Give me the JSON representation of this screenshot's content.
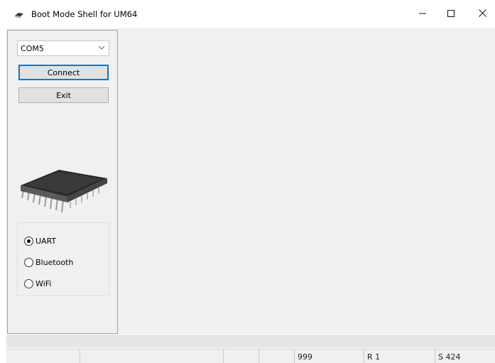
{
  "window": {
    "title": "Boot Mode Shell for UM64"
  },
  "controls": {
    "port_value": "COM5",
    "connect_label": "Connect",
    "exit_label": "Exit"
  },
  "radios": [
    {
      "label": "UART",
      "checked": true
    },
    {
      "label": "Bluetooth",
      "checked": false
    },
    {
      "label": "WiFi",
      "checked": false
    }
  ],
  "status": {
    "cells": [
      "",
      "",
      "",
      "",
      "999",
      "R 1",
      "S 424"
    ]
  },
  "icons": {
    "app": "app-icon",
    "minimize": "minimize-icon",
    "maximize": "maximize-icon",
    "close": "close-icon",
    "dropdown": "chevron-down-icon",
    "chip": "chip-icon"
  },
  "colors": {
    "focus_border": "#0078d7",
    "panel_bg": "#f0f0f0"
  }
}
